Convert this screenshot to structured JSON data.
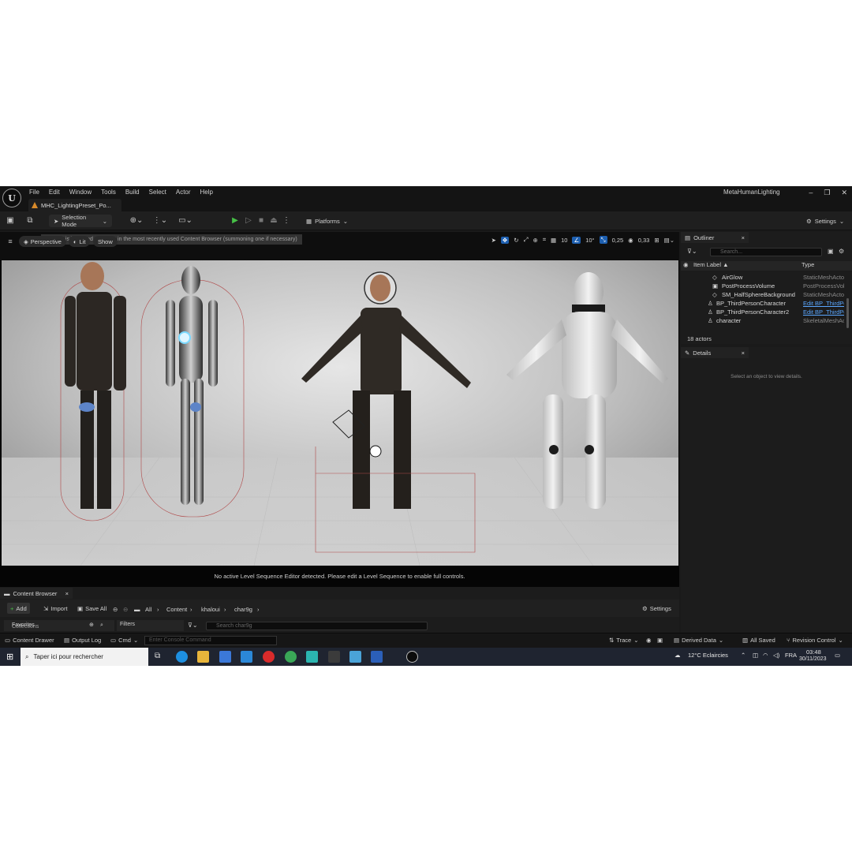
{
  "titlebar": {
    "logo": "U",
    "menu": [
      "File",
      "Edit",
      "Window",
      "Tools",
      "Build",
      "Select",
      "Actor",
      "Help"
    ],
    "doc_tab": "MHC_LightingPreset_Po...",
    "project": "MetaHumanLighting",
    "controls": [
      "–",
      "❐",
      "✕"
    ]
  },
  "toolbar": {
    "selection_mode": "Selection Mode",
    "platforms": "Platforms",
    "settings": "Settings"
  },
  "viewport": {
    "perspective": "Perspective",
    "lit": "Lit",
    "show": "Show",
    "tooltip": "Finds this level and selects it in the most recently used Content Browser (summoning one if necessary)",
    "grid_snap": "10",
    "rot_snap": "10°",
    "scale_snap": "0,25",
    "cam_speed": "0,33",
    "sequence_message": "No active Level Sequence Editor detected. Please edit a Level Sequence to enable full controls."
  },
  "outliner": {
    "tab": "Outliner",
    "search_placeholder": "Search...",
    "col_label": "Item Label ▲",
    "col_type": "Type",
    "rows": [
      {
        "label": "AirGlow",
        "type": "StaticMeshActor",
        "indent": 2
      },
      {
        "label": "PostProcessVolume",
        "type": "PostProcessVolume",
        "indent": 2
      },
      {
        "label": "SM_HalfSphereBackground",
        "type": "StaticMeshActor",
        "indent": 2
      },
      {
        "label": "BP_ThirdPersonCharacter",
        "type": "Edit BP_ThirdPe",
        "indent": 1,
        "link": true
      },
      {
        "label": "BP_ThirdPersonCharacter2",
        "type": "Edit BP_ThirdPe",
        "indent": 1,
        "link": true
      },
      {
        "label": "character",
        "type": "SkeletalMeshActor",
        "indent": 1
      }
    ],
    "actors": "18 actors"
  },
  "details": {
    "tab": "Details",
    "empty": "Select an object to view details."
  },
  "content_browser": {
    "tab": "Content Browser",
    "add": "Add",
    "import": "Import",
    "save_all": "Save All",
    "crumbs": [
      "All",
      "Content",
      "khaloui",
      "char9g"
    ],
    "settings": "Settings",
    "favorites": "Favorites",
    "collections": "Collections",
    "filters": "Filters",
    "search_placeholder": "Search char9g"
  },
  "statusbar": {
    "content_drawer": "Content Drawer",
    "output_log": "Output Log",
    "cmd": "Cmd",
    "console_placeholder": "Enter Console Command",
    "trace": "Trace",
    "derived_data": "Derived Data",
    "all_saved": "All Saved",
    "revision_control": "Revision Control"
  },
  "taskbar": {
    "search": "Taper ici pour rechercher",
    "weather": "12°C  Eclaircies",
    "lang": "FRA",
    "time": "03:48",
    "date": "30/11/2023"
  },
  "colors": {
    "accent_blue": "#1d5fb0",
    "play_green": "#46c046",
    "link_blue": "#5aa7ff"
  }
}
